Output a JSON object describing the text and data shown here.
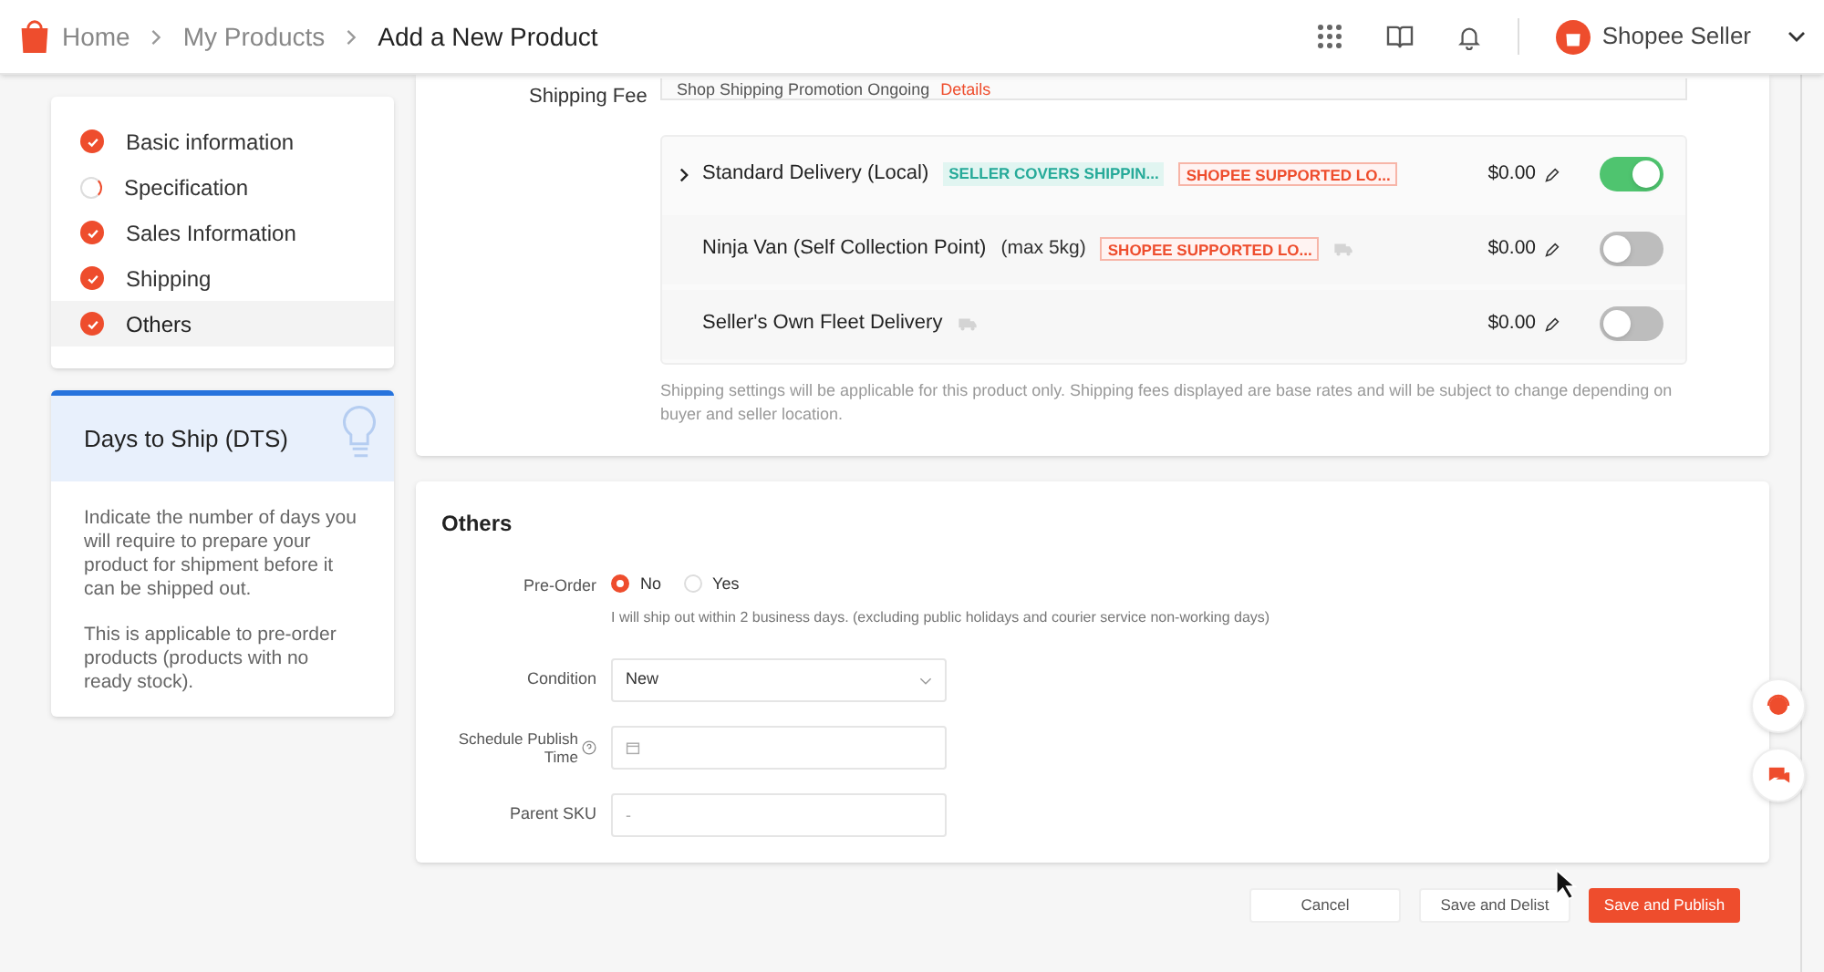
{
  "header": {
    "breadcrumb": [
      "Home",
      "My Products",
      "Add a New Product"
    ],
    "account": "Shopee Seller"
  },
  "steps": [
    {
      "label": "Basic information",
      "done": true,
      "selected": false
    },
    {
      "label": "Specification",
      "done": false,
      "selected": false
    },
    {
      "label": "Sales Information",
      "done": true,
      "selected": false
    },
    {
      "label": "Shipping",
      "done": true,
      "selected": false
    },
    {
      "label": "Others",
      "done": true,
      "selected": true
    }
  ],
  "tip": {
    "title": "Days to Ship (DTS)",
    "paragraphs": [
      "Indicate the number of days you will require to prepare your product for shipment before it can be shipped out.",
      "This is applicable to pre-order products (products with no ready stock)."
    ]
  },
  "shipping": {
    "label": "Shipping Fee",
    "promotion": "Shop Shipping Promotion Ongoing",
    "promotion_link": "Details",
    "options": [
      {
        "name": "Standard Delivery (Local)",
        "expandable": true,
        "tags": [
          {
            "text": "SELLER COVERS SHIPPIN...",
            "kind": "teal"
          },
          {
            "text": "SHOPEE SUPPORTED LO...",
            "kind": "red"
          }
        ],
        "truck": false,
        "price": "$0.00",
        "on": true
      },
      {
        "name": "Ninja Van (Self Collection Point)",
        "note": "(max 5kg)",
        "expandable": false,
        "tags": [
          {
            "text": "SHOPEE SUPPORTED LO...",
            "kind": "red"
          }
        ],
        "truck": true,
        "price": "$0.00",
        "on": false
      },
      {
        "name": "Seller's Own Fleet Delivery",
        "expandable": false,
        "truck": true,
        "price": "$0.00",
        "on": false
      }
    ],
    "footnote": "Shipping settings will be applicable for this product only. Shipping fees displayed are base rates and will be subject to change depending on buyer and seller location."
  },
  "others": {
    "title": "Others",
    "preorder": {
      "label": "Pre-Order",
      "options": [
        {
          "label": "No",
          "selected": true
        },
        {
          "label": "Yes",
          "selected": false
        }
      ],
      "hint": "I will ship out within 2 business days. (excluding public holidays and courier service non-working days)"
    },
    "condition": {
      "label": "Condition",
      "value": "New"
    },
    "schedule": {
      "label": "Schedule Publish Time"
    },
    "sku": {
      "label": "Parent SKU",
      "placeholder": "-"
    }
  },
  "buttons": [
    {
      "label": "Cancel",
      "kind": "plain"
    },
    {
      "label": "Save and Delist",
      "kind": "plain"
    },
    {
      "label": "Save and Publish",
      "kind": "primary"
    }
  ]
}
